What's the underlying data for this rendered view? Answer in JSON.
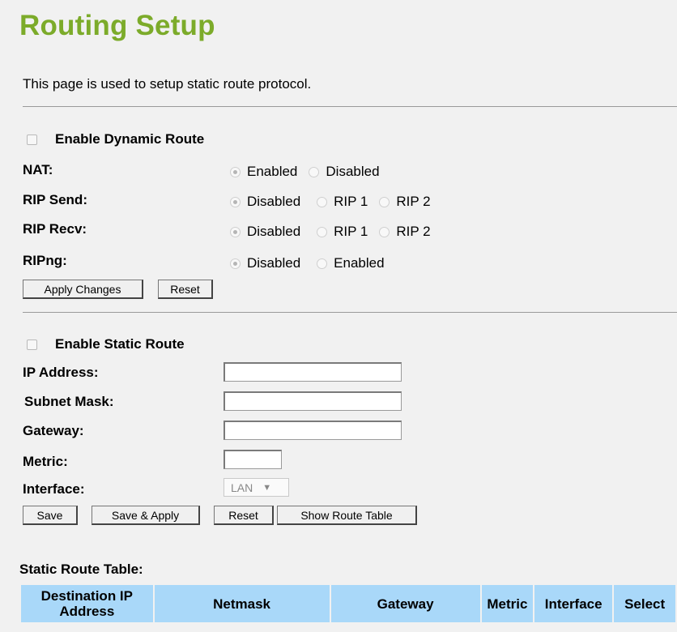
{
  "title": "Routing Setup",
  "description": "This page is used to setup static route protocol.",
  "dynamic": {
    "enable_label": "Enable Dynamic Route",
    "nat": {
      "label": "NAT:",
      "options": [
        "Enabled",
        "Disabled"
      ],
      "selected": 0
    },
    "rip_send": {
      "label": "RIP Send:",
      "options": [
        "Disabled",
        "RIP 1",
        "RIP 2"
      ],
      "selected": 0
    },
    "rip_recv": {
      "label": "RIP Recv:",
      "options": [
        "Disabled",
        "RIP 1",
        "RIP 2"
      ],
      "selected": 0
    },
    "ripng": {
      "label": "RIPng:",
      "options": [
        "Disabled",
        "Enabled"
      ],
      "selected": 0
    },
    "apply_label": "Apply Changes",
    "reset_label": "Reset"
  },
  "static": {
    "enable_label": "Enable Static Route",
    "ip_label": "IP Address:",
    "ip_value": "",
    "subnet_label": "Subnet Mask:",
    "subnet_value": "",
    "gateway_label": "Gateway:",
    "gateway_value": "",
    "metric_label": "Metric:",
    "metric_value": "",
    "interface_label": "Interface:",
    "interface_value": "LAN",
    "save_label": "Save",
    "save_apply_label": "Save & Apply",
    "reset_label": "Reset",
    "show_table_label": "Show Route Table"
  },
  "table": {
    "title": "Static Route Table:",
    "headers": [
      "Destination IP Address",
      "Netmask",
      "Gateway",
      "Metric",
      "Interface",
      "Select"
    ]
  }
}
